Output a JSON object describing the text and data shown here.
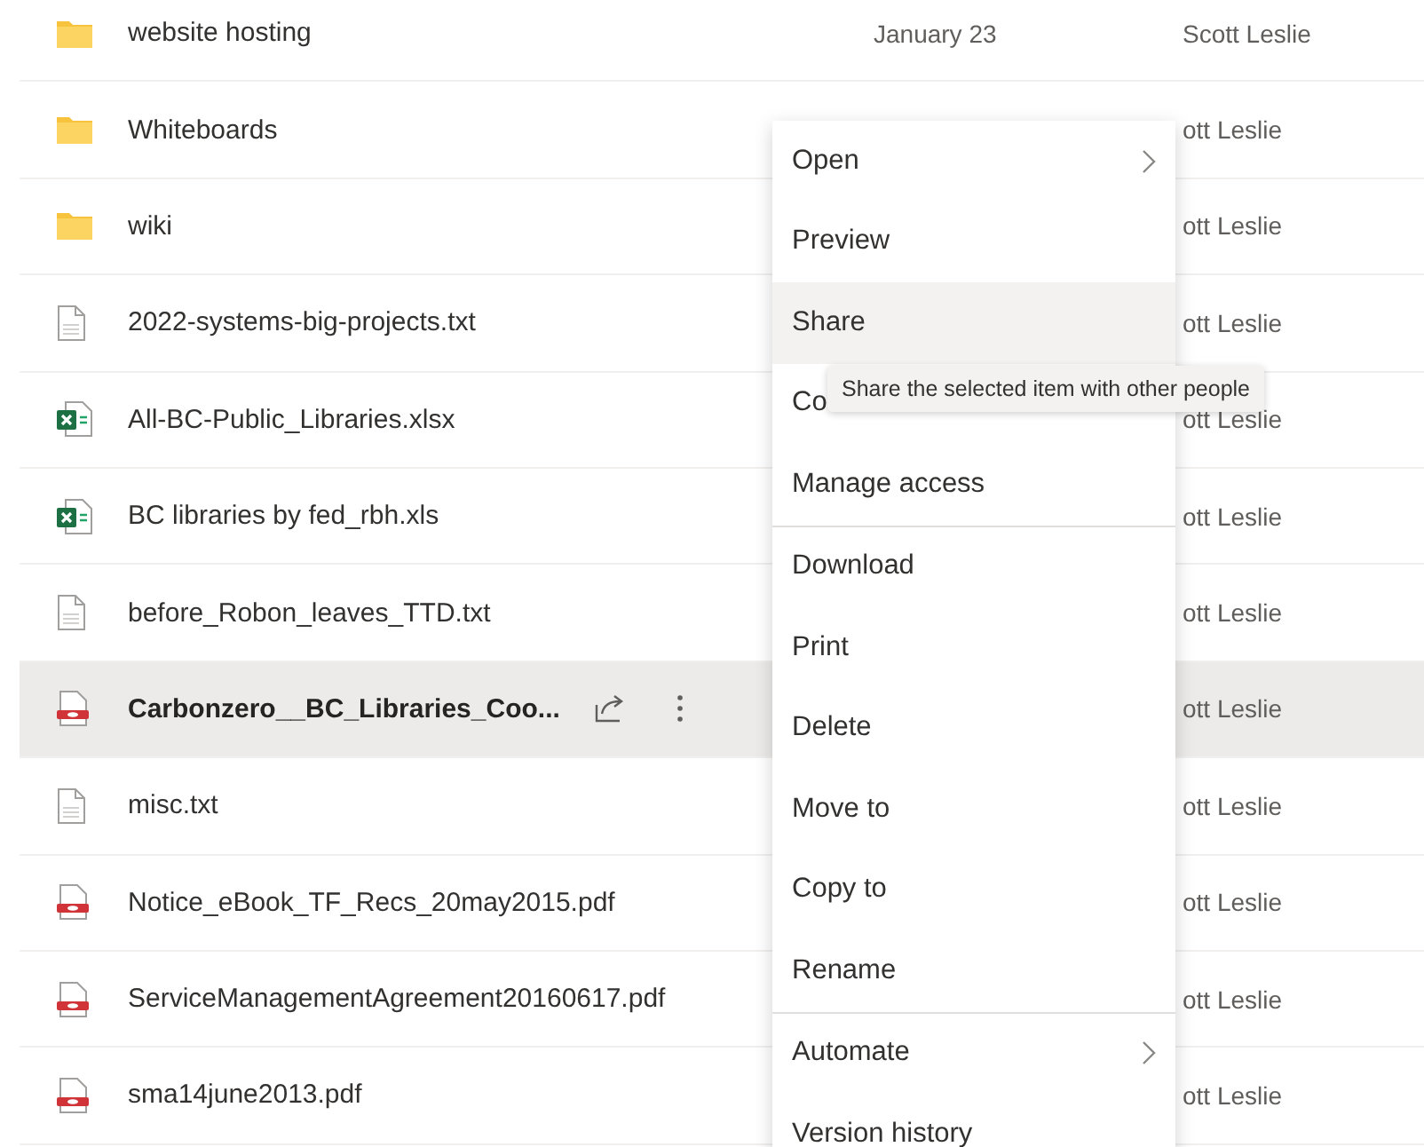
{
  "files": [
    {
      "name": "website hosting",
      "kind": "folder",
      "modified": "January 23",
      "author": "Scott Leslie",
      "selected": false
    },
    {
      "name": "Whiteboards",
      "kind": "folder",
      "author": "ott Leslie",
      "selected": false
    },
    {
      "name": "wiki",
      "kind": "folder",
      "author": "ott Leslie",
      "selected": false
    },
    {
      "name": "2022-systems-big-projects.txt",
      "kind": "text",
      "author": "ott Leslie",
      "selected": false
    },
    {
      "name": "All-BC-Public_Libraries.xlsx",
      "kind": "excel",
      "author": "ott Leslie",
      "selected": false
    },
    {
      "name": "BC libraries by fed_rbh.xls",
      "kind": "excel",
      "author": "ott Leslie",
      "selected": false
    },
    {
      "name": "before_Robon_leaves_TTD.txt",
      "kind": "text",
      "author": "ott Leslie",
      "selected": false
    },
    {
      "name": "Carbonzero__BC_Libraries_Coo...",
      "kind": "pdf",
      "author": "ott Leslie",
      "selected": true
    },
    {
      "name": "misc.txt",
      "kind": "text",
      "author": "ott Leslie",
      "selected": false
    },
    {
      "name": "Notice_eBook_TF_Recs_20may2015.pdf",
      "kind": "pdf",
      "author": "ott Leslie",
      "selected": false
    },
    {
      "name": "ServiceManagementAgreement20160617.pdf",
      "kind": "pdf",
      "author": "ott Leslie",
      "selected": false
    },
    {
      "name": "sma14june2013.pdf",
      "kind": "pdf",
      "author": "ott Leslie",
      "selected": false
    }
  ],
  "menu": {
    "groups": [
      [
        {
          "label": "Open",
          "submenu": true,
          "hovered": false
        },
        {
          "label": "Preview",
          "submenu": false,
          "hovered": false
        },
        {
          "label": "Share",
          "submenu": false,
          "hovered": true
        },
        {
          "label": "Co",
          "submenu": false,
          "hovered": false
        },
        {
          "label": "Manage access",
          "submenu": false,
          "hovered": false
        }
      ],
      [
        {
          "label": "Download",
          "submenu": false,
          "hovered": false
        },
        {
          "label": "Print",
          "submenu": false,
          "hovered": false
        },
        {
          "label": "Delete",
          "submenu": false,
          "hovered": false
        },
        {
          "label": "Move to",
          "submenu": false,
          "hovered": false
        },
        {
          "label": "Copy to",
          "submenu": false,
          "hovered": false
        },
        {
          "label": "Rename",
          "submenu": false,
          "hovered": false
        }
      ],
      [
        {
          "label": "Automate",
          "submenu": true,
          "hovered": false
        },
        {
          "label": "Version history",
          "submenu": false,
          "hovered": false
        }
      ]
    ]
  },
  "tooltip": "Share the selected item with other people"
}
